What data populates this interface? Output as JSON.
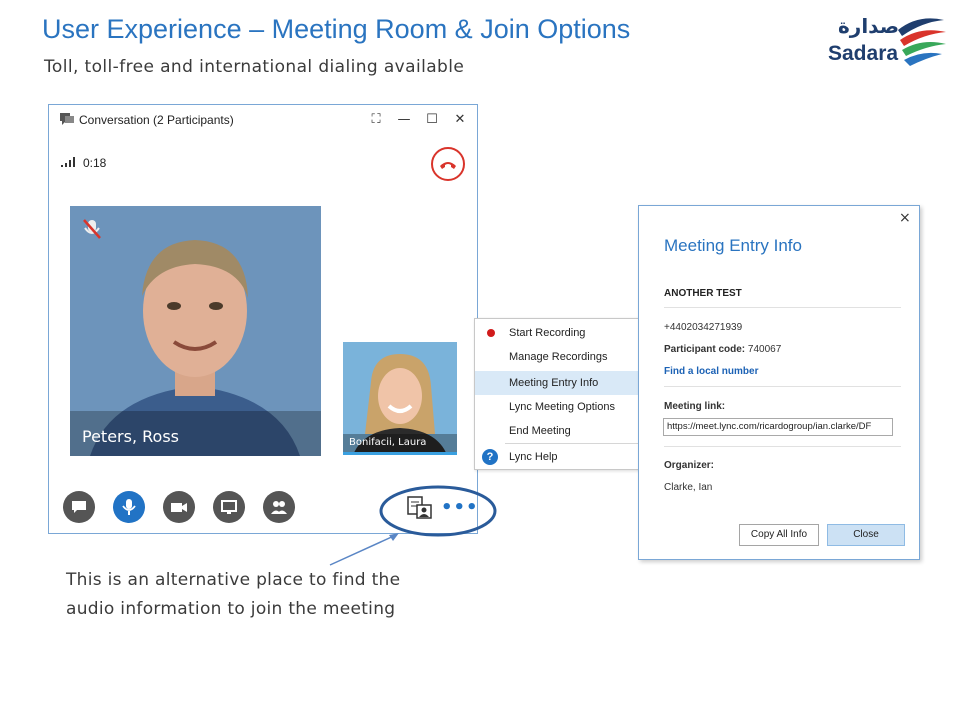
{
  "slide": {
    "title": "User Experience – Meeting Room & Join Options",
    "subtitle": "Toll, toll-free and international dialing available",
    "logo": {
      "arabic": "صدارة",
      "english": "Sadara",
      "colors": [
        "#1f3e6e",
        "#d9342b",
        "#39a85a",
        "#2a74c0"
      ]
    }
  },
  "conversation_window": {
    "title": "Conversation (2 Participants)",
    "timer": "0:18",
    "participants": {
      "main": "Peters, Ross",
      "secondary": "Bonifacii, Laura"
    },
    "toolbar": [
      "chat-icon",
      "microphone-icon",
      "video-icon",
      "present-icon",
      "people-icon"
    ],
    "more_label": "•••"
  },
  "context_menu": {
    "items": [
      {
        "label": "Start Recording",
        "icon": "record-dot-icon"
      },
      {
        "label": "Manage Recordings",
        "icon": ""
      },
      {
        "label": "Meeting Entry Info",
        "icon": "",
        "highlighted": true
      },
      {
        "label": "Lync Meeting Options",
        "icon": ""
      },
      {
        "label": "End Meeting",
        "icon": ""
      },
      {
        "label": "Lync Help",
        "icon": "help-icon"
      }
    ]
  },
  "meeting_dialog": {
    "close": "×",
    "title": "Meeting Entry Info",
    "meeting_name": "ANOTHER TEST",
    "phone": "+4402034271939",
    "participant_code_label": "Participant code:",
    "participant_code": "740067",
    "find_local": "Find a local number",
    "meeting_link_label": "Meeting link:",
    "meeting_link": "https://meet.lync.com/ricardogroup/ian.clarke/DF",
    "organizer_label": "Organizer:",
    "organizer": "Clarke, Ian",
    "copy_button": "Copy All Info",
    "close_button": "Close"
  },
  "callout": {
    "line1": "This is an alternative place to find the",
    "line2": "audio information to join the meeting"
  }
}
